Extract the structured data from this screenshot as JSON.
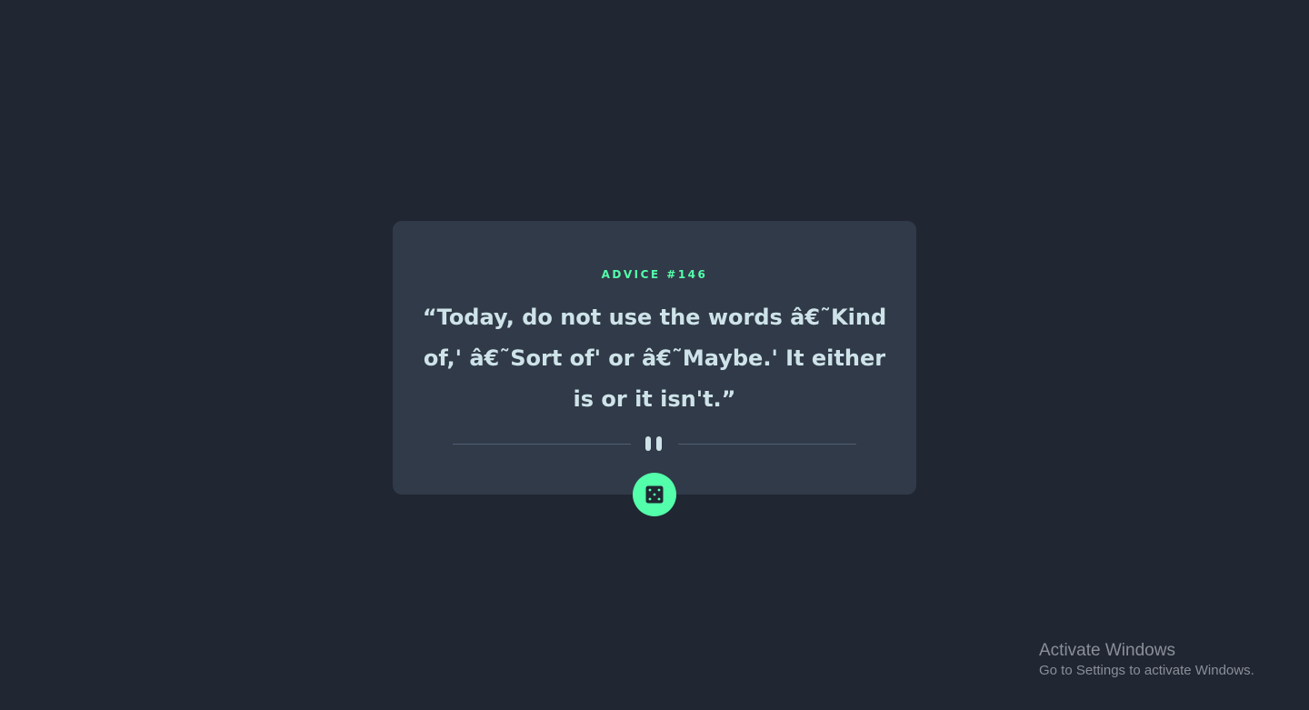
{
  "advice": {
    "label": "ADVICE #146",
    "quote": "“Today, do not use the words â€˜Kind of,' â€˜Sort of' or â€˜Maybe.' It either is or it isn't.”"
  },
  "divider": {
    "icon": "pause-icon"
  },
  "dice_button": {
    "icon": "dice-icon"
  },
  "watermark": {
    "title": "Activate Windows",
    "subtitle": "Go to Settings to activate Windows."
  },
  "colors": {
    "background": "#202632",
    "card": "#313a48",
    "accent": "#53ffaa",
    "text": "#cee3e9",
    "divider": "#4f5d74"
  }
}
